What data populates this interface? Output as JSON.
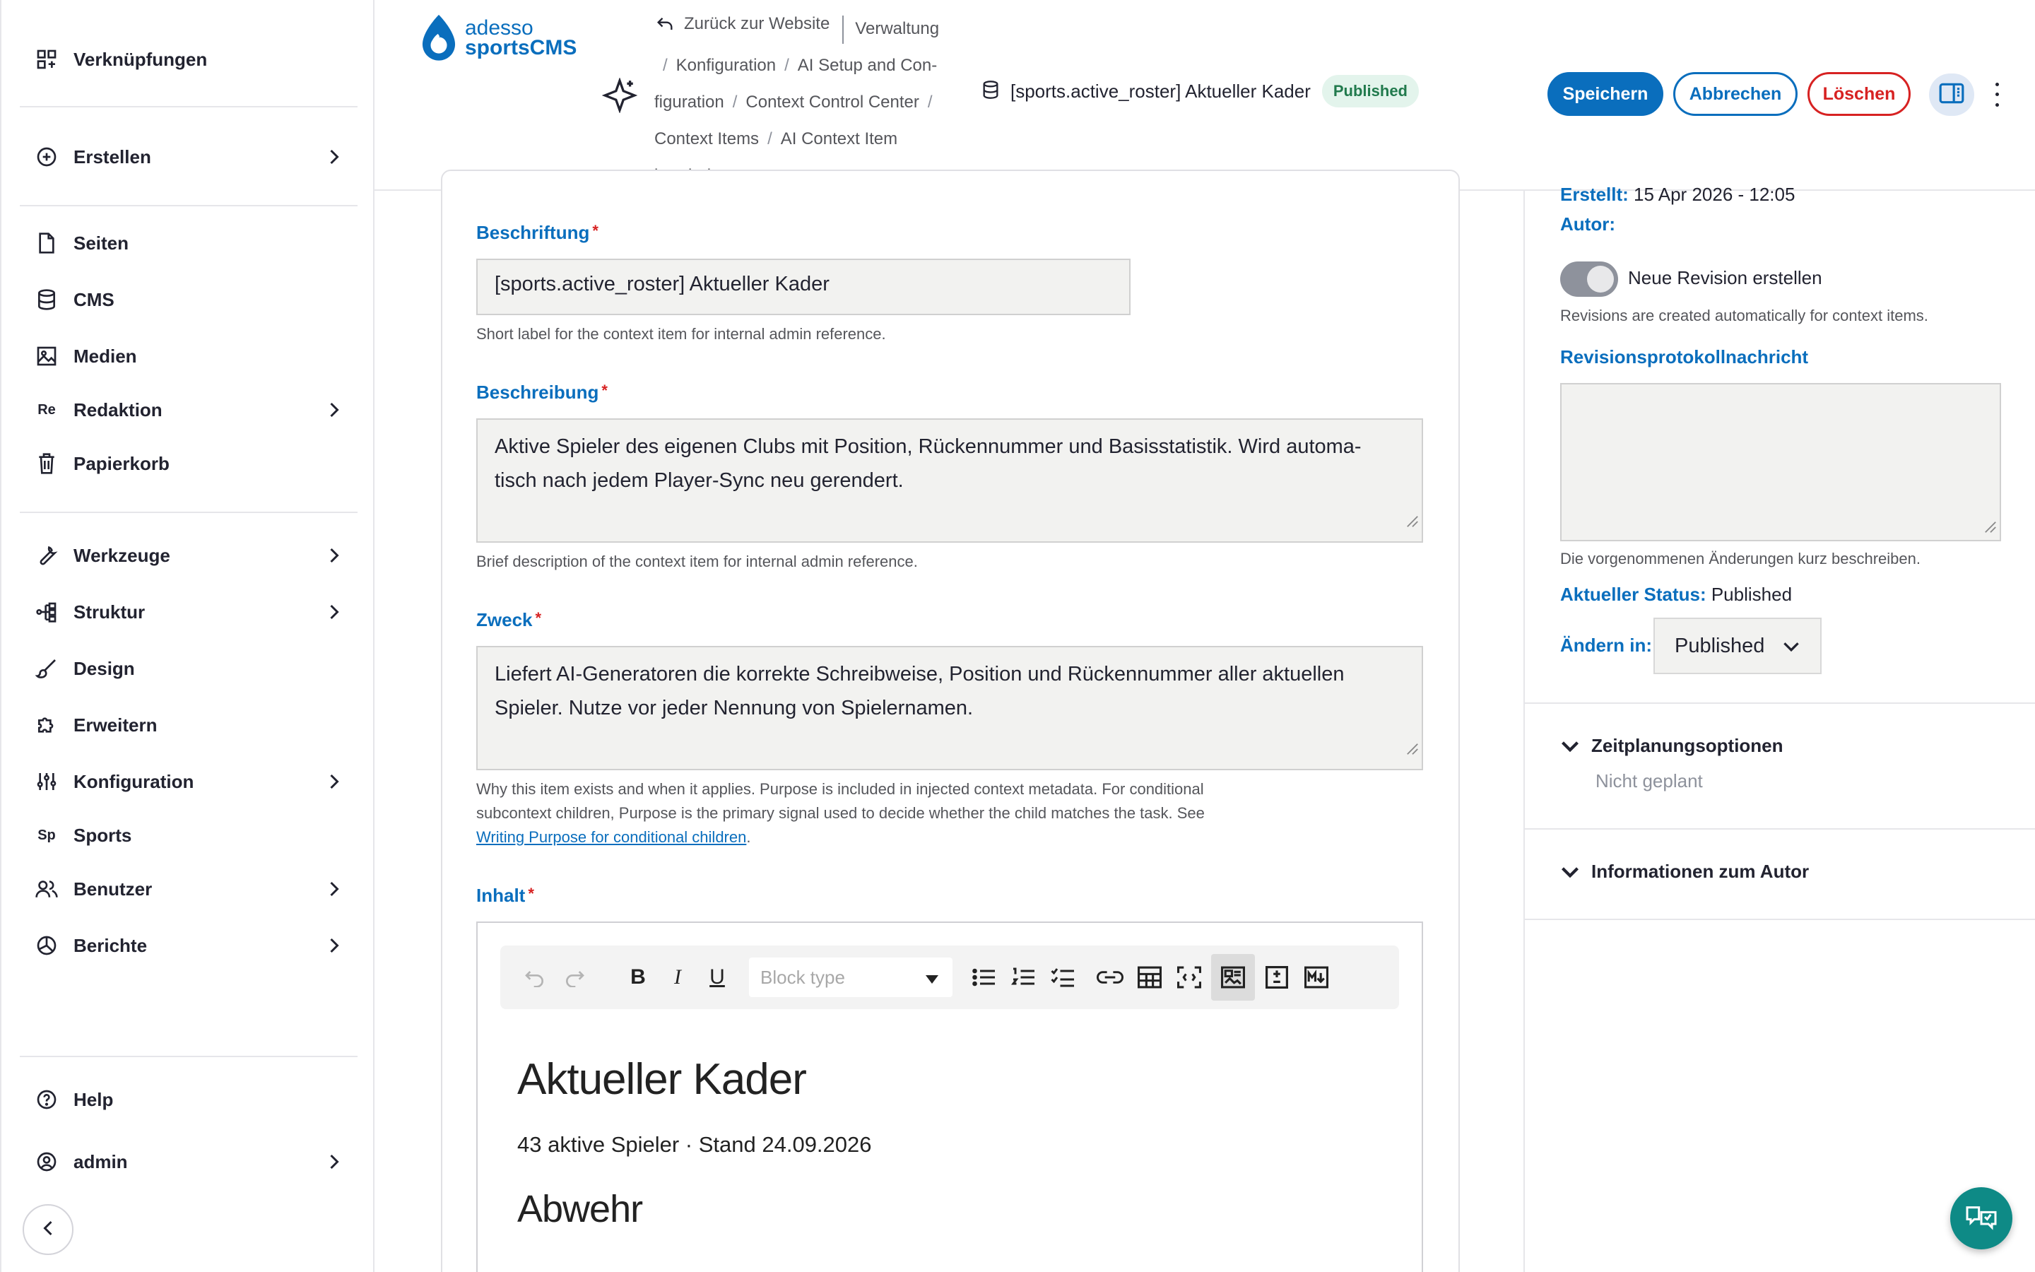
{
  "sidebar": {
    "items": [
      {
        "label": "Verknüpfungen",
        "icon": "shortcuts-icon"
      },
      {
        "label": "Erstellen",
        "icon": "plus-circle-icon"
      },
      {
        "label": "Seiten",
        "icon": "page-icon"
      },
      {
        "label": "CMS",
        "icon": "database-icon"
      },
      {
        "label": "Medien",
        "icon": "image-icon"
      },
      {
        "label": "Redaktion",
        "icon": "Re"
      },
      {
        "label": "Papierkorb",
        "icon": "trash-icon"
      },
      {
        "label": "Werkzeuge",
        "icon": "wrench-icon"
      },
      {
        "label": "Struktur",
        "icon": "structure-icon"
      },
      {
        "label": "Design",
        "icon": "brush-icon"
      },
      {
        "label": "Erweitern",
        "icon": "puzzle-icon"
      },
      {
        "label": "Konfiguration",
        "icon": "sliders-icon"
      },
      {
        "label": "Sports",
        "icon": "Sp"
      },
      {
        "label": "Benutzer",
        "icon": "users-icon"
      },
      {
        "label": "Berichte",
        "icon": "chart-pie-icon"
      },
      {
        "label": "Help",
        "icon": "help-icon"
      },
      {
        "label": "admin",
        "icon": "user-circle-icon"
      }
    ]
  },
  "header": {
    "logo": {
      "line1": "adesso",
      "line2": "sportsCMS"
    },
    "back_link": "Zurück zur Website",
    "crumbs": {
      "c1": "Verwaltung",
      "c2": "Konfiguration",
      "c3a": "AI Setup and Con-",
      "c3b": "figuration",
      "c4": "Context Control Center",
      "c5": "Context Items",
      "c6": "AI Context Item",
      "c7": "bearbeiten"
    },
    "title": "[sports.active_roster] Aktueller Kader",
    "badge": "Published",
    "save": "Speichern",
    "cancel": "Abbrechen",
    "delete": "Löschen"
  },
  "form": {
    "label_field": {
      "label": "Beschriftung",
      "required": "*",
      "value": "[sports.active_roster] Aktueller Kader",
      "help": "Short label for the context item for internal admin reference."
    },
    "description": {
      "label": "Beschreibung",
      "required": "*",
      "line1": "Aktive Spieler des eigenen Clubs mit Position, Rückennummer und Basisstatistik. Wird automa-",
      "line2": "tisch nach jedem Player-Sync neu gerendert.",
      "help": "Brief description of the context item for internal admin reference."
    },
    "purpose": {
      "label": "Zweck",
      "required": "*",
      "line1": "Liefert AI-Generatoren die korrekte Schreibweise, Position und Rückennummer aller aktuellen",
      "line2": "Spieler. Nutze vor jeder Nennung von Spielernamen.",
      "help1": "Why this item exists and when it applies. Purpose is included in injected context metadata. For conditional",
      "help2": "subcontext children, Purpose is the primary signal used to decide whether the child matches the task. See",
      "help_link": "Writing Purpose for conditional children",
      "help_end": "."
    },
    "content": {
      "label": "Inhalt",
      "required": "*",
      "block_type_placeholder": "Block type",
      "h1": "Aktueller Kader",
      "p": "43 aktive Spieler · Stand 24.09.2026",
      "h2": "Abwehr"
    }
  },
  "right": {
    "created_label": "Erstellt:",
    "created_value": "15 Apr 2026 - 12:05",
    "author_label": "Autor:",
    "revision_toggle": "Neue Revision erstellen",
    "revision_note": "Revisions are created automatically for context items.",
    "revlog_label": "Revisionsprotokollnachricht",
    "revlog_help": "Die vorgenommenen Änderungen kurz beschreiben.",
    "status_label": "Aktueller Status:",
    "status_value": "Published",
    "change_label": "Ändern in:",
    "change_value": "Published",
    "scheduling": {
      "title": "Zeitplanungsoptionen",
      "sub": "Nicht geplant"
    },
    "author_info": {
      "title": "Informationen zum Autor"
    }
  },
  "colors": {
    "accent": "#0a6ebd",
    "danger": "#d72222",
    "badge_bg": "#e3f4ec",
    "badge_fg": "#217a4d",
    "fab": "#0e8a86"
  }
}
